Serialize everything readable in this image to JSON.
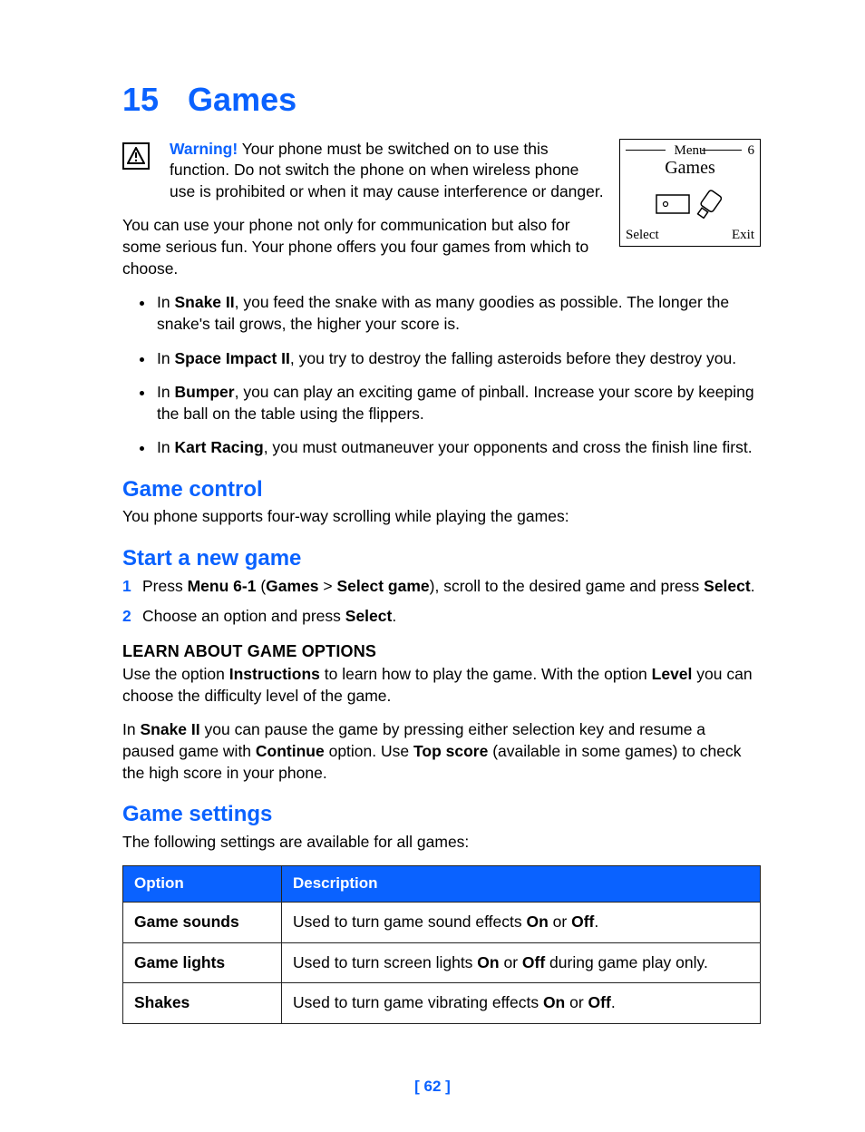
{
  "chapter": {
    "number": "15",
    "title": "Games"
  },
  "warning": {
    "label": "Warning!",
    "text": " Your phone must be switched on to use this function. Do not switch the phone on when wireless phone use is prohibited or when it may cause interference or danger."
  },
  "screen": {
    "menu_label": "Menu",
    "menu_number": "6",
    "title": "Games",
    "softkey_left": "Select",
    "softkey_right": "Exit"
  },
  "intro": "You can use your phone not only for communication but also for some serious fun. Your phone offers you four games from which to choose.",
  "bullets": [
    {
      "pre": "In ",
      "name": "Snake II",
      "post": ", you feed the snake with as many goodies as possible. The longer the snake's tail grows, the higher your score is."
    },
    {
      "pre": "In ",
      "name": "Space Impact II",
      "post": ", you try to destroy the falling asteroids before they destroy you."
    },
    {
      "pre": "In ",
      "name": "Bumper",
      "post": ", you can play an exciting game of pinball. Increase your score by keeping the ball on the table using the flippers."
    },
    {
      "pre": "In ",
      "name": "Kart Racing",
      "post": ", you must outmaneuver your opponents and cross the finish line first."
    }
  ],
  "game_control": {
    "heading": "Game control",
    "text": "You phone supports four-way scrolling while playing the games:"
  },
  "start_game": {
    "heading": "Start a new game",
    "steps": [
      {
        "num": "1",
        "parts": [
          "Press ",
          "Menu 6-1",
          " (",
          "Games",
          " > ",
          "Select game",
          "), scroll to the desired game and press ",
          "Select",
          "."
        ]
      },
      {
        "num": "2",
        "parts": [
          "Choose an option and press ",
          "Select",
          "."
        ]
      }
    ]
  },
  "learn": {
    "heading": "LEARN ABOUT GAME OPTIONS",
    "p1_parts": [
      "Use the option ",
      "Instructions",
      " to learn how to play the game. With the option ",
      "Level",
      " you can choose the difficulty level of the game."
    ],
    "p2_parts": [
      "In ",
      "Snake II",
      " you can pause the game by pressing either selection key and resume a paused game with ",
      "Continue",
      " option. Use ",
      "Top score",
      " (available in some games) to check the high score in your phone."
    ]
  },
  "settings": {
    "heading": "Game settings",
    "intro": "The following settings are available for all games:",
    "headers": {
      "option": "Option",
      "description": "Description"
    },
    "rows": [
      {
        "option": "Game sounds",
        "pre": "Used to turn game sound effects ",
        "b1": "On",
        "mid": " or ",
        "b2": "Off",
        "post": "."
      },
      {
        "option": "Game lights",
        "pre": "Used to turn screen lights ",
        "b1": "On",
        "mid": " or ",
        "b2": "Off",
        "post": " during game play only."
      },
      {
        "option": "Shakes",
        "pre": "Used to turn game vibrating effects ",
        "b1": "On",
        "mid": " or ",
        "b2": "Off",
        "post": "."
      }
    ]
  },
  "page_number": "[ 62 ]"
}
